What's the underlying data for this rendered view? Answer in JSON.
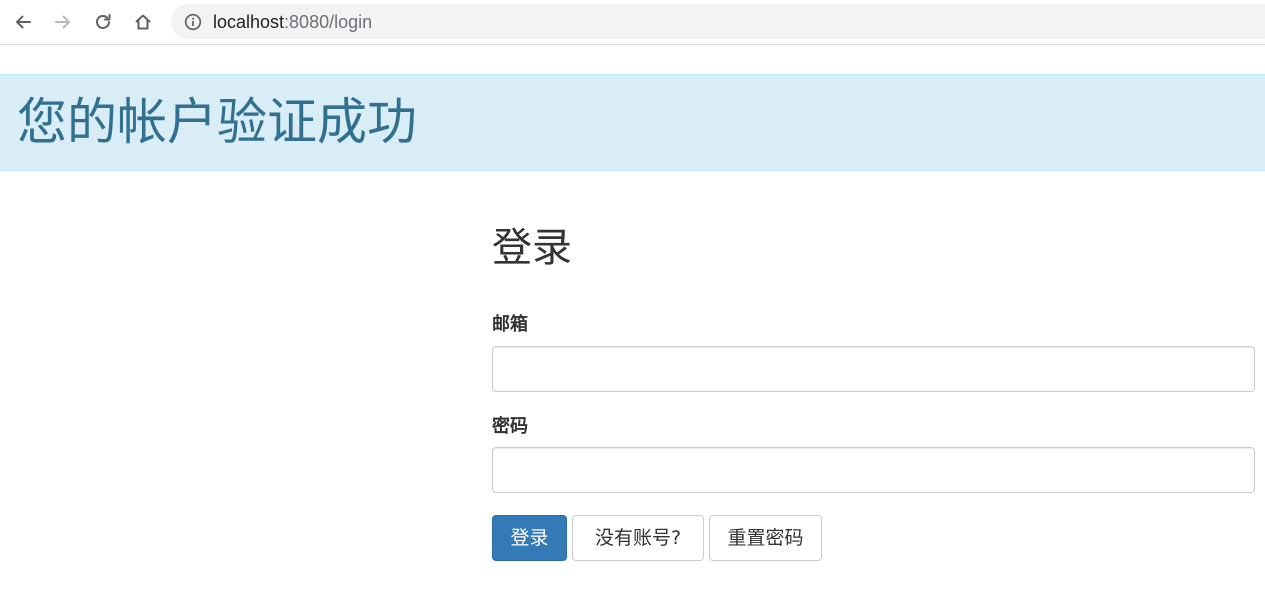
{
  "browser": {
    "url_host": "localhost",
    "url_path": ":8080/login",
    "icons": {
      "back": "back-arrow-icon",
      "forward": "forward-arrow-icon",
      "reload": "reload-icon",
      "home": "home-icon",
      "info": "info-icon"
    }
  },
  "alert": {
    "message": "您的帐户验证成功",
    "background": "#d9edf7",
    "text_color": "#31708f"
  },
  "login": {
    "title": "登录",
    "email_label": "邮箱",
    "email_value": "",
    "password_label": "密码",
    "password_value": "",
    "buttons": {
      "submit": "登录",
      "register": "没有账号?",
      "reset_password": "重置密码"
    },
    "primary_color": "#337ab7"
  }
}
